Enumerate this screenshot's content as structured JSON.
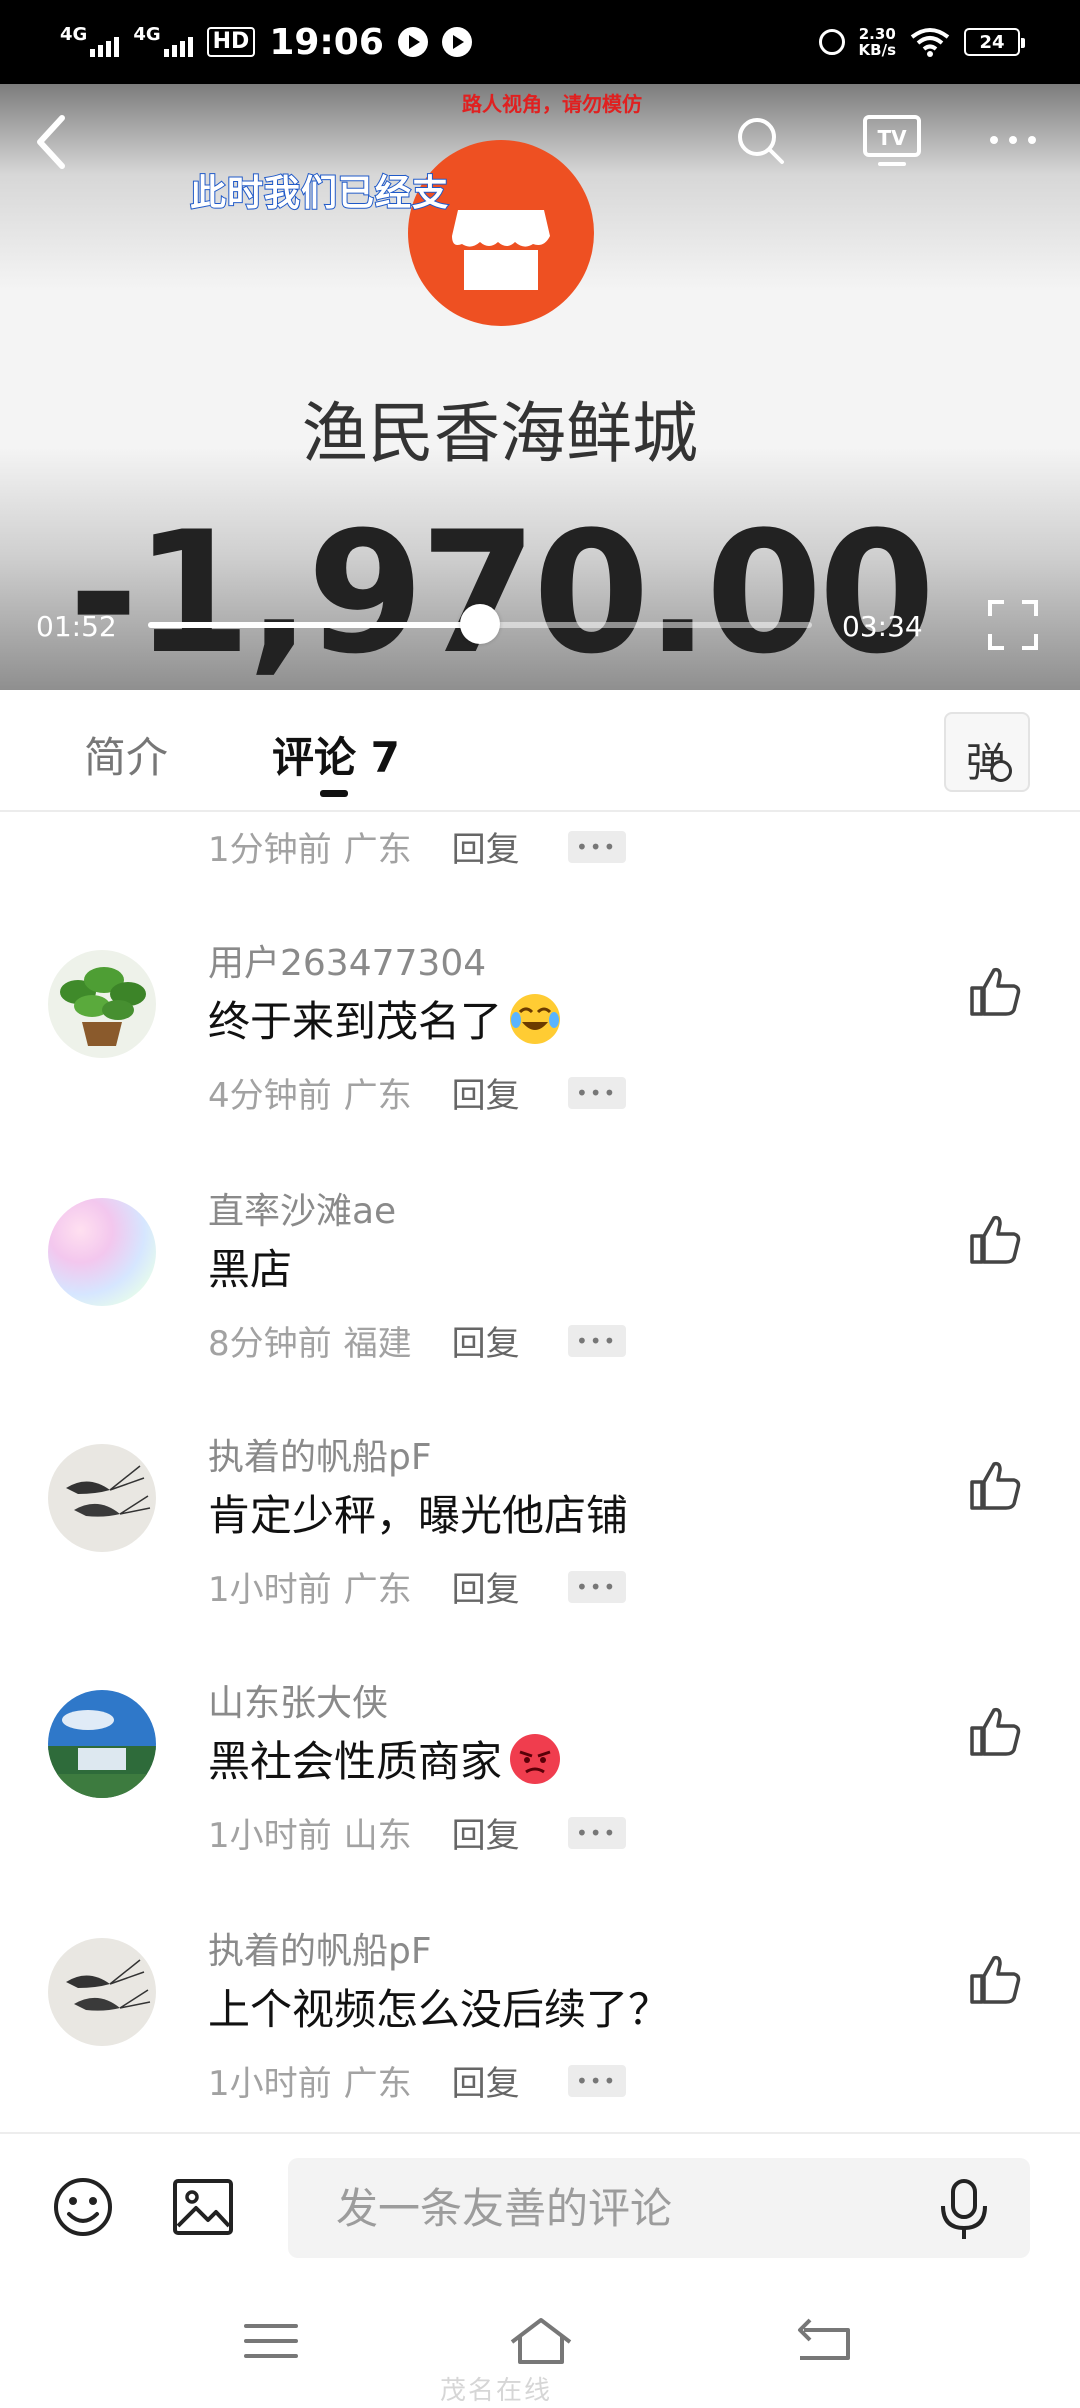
{
  "status_bar": {
    "network_1": "4G",
    "network_2": "4G",
    "hd_label": "HD",
    "time": "19:06",
    "net_speed_value": "2.30",
    "net_speed_unit": "KB/s",
    "battery": "24"
  },
  "video": {
    "watermark": "路人视角，请勿模仿",
    "subtitle": "此时我们已经支",
    "merchant_name": "渔民香海鲜城",
    "amount": "-1,970.00",
    "current_time": "01:52",
    "total_time": "03:34",
    "progress": 0.5
  },
  "tabs": {
    "intro": "简介",
    "comments": "评论 7",
    "danmaku": "弹"
  },
  "partial_comment": {
    "time": "1分钟前",
    "location": "广东",
    "reply": "回复"
  },
  "comments": [
    {
      "username": "用户263477304",
      "text": "终于来到茂名了",
      "emoji": "crying-laughing-emoji",
      "time": "4分钟前",
      "location": "广东",
      "reply": "回复",
      "avatar": "plant-avatar"
    },
    {
      "username": "直率沙滩ae",
      "text": "黑店",
      "emoji": "",
      "time": "8分钟前",
      "location": "福建",
      "reply": "回复",
      "avatar": "iridescent-avatar"
    },
    {
      "username": "执着的帆船pF",
      "text": "肯定少秤，曝光他店铺",
      "emoji": "",
      "time": "1小时前",
      "location": "广东",
      "reply": "回复",
      "avatar": "shrimp-painting-avatar"
    },
    {
      "username": "山东张大侠",
      "text": "黑社会性质商家",
      "emoji": "angry-face-emoji",
      "time": "1小时前",
      "location": "山东",
      "reply": "回复",
      "avatar": "waterfall-landscape-avatar"
    },
    {
      "username": "执着的帆船pF",
      "text": "上个视频怎么没后续了？",
      "emoji": "",
      "time": "1小时前",
      "location": "广东",
      "reply": "回复",
      "avatar": "shrimp-painting-avatar"
    }
  ],
  "input_bar": {
    "placeholder": "发一条友善的评论"
  },
  "watermark_bottom": "茂名在线",
  "colors": {
    "accent_orange": "#ee5022",
    "subtitle_stroke": "#1f59c8",
    "watermark_red": "#e02020",
    "text_muted": "#a2a2a2"
  }
}
